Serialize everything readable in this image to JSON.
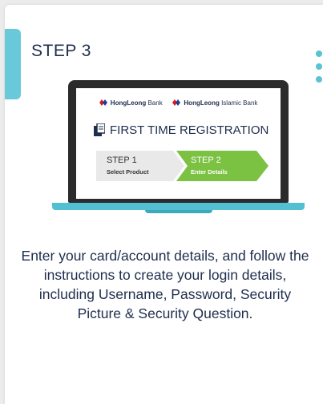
{
  "card": {
    "step_title": "STEP 3",
    "accent_color": "#69c8da",
    "text_color": "#1f2e4d"
  },
  "illustration": {
    "banks": [
      {
        "bold": "HongLeong",
        "rest": " Bank",
        "logo": "hong-leong-logo-icon"
      },
      {
        "bold": "HongLeong",
        "rest": " Islamic Bank",
        "logo": "hong-leong-logo-icon"
      }
    ],
    "registration_title": "FIRST TIME REGISTRATION",
    "registration_icon": "document-icon",
    "steps": [
      {
        "title": "STEP 1",
        "subtitle": "Select Product",
        "color": "#e9e9e9"
      },
      {
        "title": "STEP 2",
        "subtitle": "Enter Details",
        "color": "#7bc142"
      }
    ]
  },
  "description": "Enter your card/account details, and follow the instructions to create your login details, including Username, Password, Security Picture & Security Question."
}
